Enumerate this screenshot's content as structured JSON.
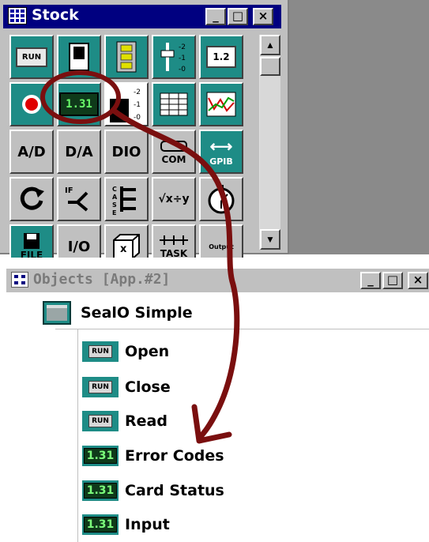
{
  "stock_window": {
    "title": "Stock",
    "buttons": [
      "_",
      "□",
      "×"
    ],
    "tools": [
      {
        "name": "run-tool",
        "kind": "run",
        "label": "RUN"
      },
      {
        "name": "switch-tool",
        "kind": "switch",
        "label": ""
      },
      {
        "name": "button-panel-tool",
        "kind": "panel",
        "label": ""
      },
      {
        "name": "slider-tool",
        "kind": "slider",
        "label": ""
      },
      {
        "name": "numeric-input-tool",
        "kind": "numeric",
        "label": "1.2"
      },
      {
        "name": "led-tool",
        "kind": "led",
        "label": ""
      },
      {
        "name": "numeric-display-tool",
        "kind": "lcd",
        "label": "1.31"
      },
      {
        "name": "bar-meter-tool",
        "kind": "bar",
        "label": ""
      },
      {
        "name": "table-tool",
        "kind": "table",
        "label": ""
      },
      {
        "name": "graph-tool",
        "kind": "graph",
        "label": ""
      },
      {
        "name": "ad-tool",
        "kind": "text",
        "label": "A/D"
      },
      {
        "name": "da-tool",
        "kind": "text",
        "label": "D/A"
      },
      {
        "name": "dio-tool",
        "kind": "text",
        "label": "DIO"
      },
      {
        "name": "com-tool",
        "kind": "com",
        "label": "COM"
      },
      {
        "name": "gpib-tool",
        "kind": "gpib",
        "label": "GPIB"
      },
      {
        "name": "loop-tool",
        "kind": "loop",
        "label": ""
      },
      {
        "name": "if-tool",
        "kind": "if",
        "label": "IF"
      },
      {
        "name": "case-tool",
        "kind": "case",
        "label": "CASE"
      },
      {
        "name": "formula-tool",
        "kind": "formula",
        "label": "√x÷y"
      },
      {
        "name": "timer-tool",
        "kind": "timer",
        "label": ""
      },
      {
        "name": "file-tool",
        "kind": "file",
        "label": "FILE"
      },
      {
        "name": "io-tool",
        "kind": "text",
        "label": "I/O"
      },
      {
        "name": "box-tool",
        "kind": "box",
        "label": "x"
      },
      {
        "name": "task-tool",
        "kind": "task",
        "label": "TASK"
      },
      {
        "name": "output-tool",
        "kind": "output",
        "label": "Output"
      }
    ]
  },
  "objects_window": {
    "title": "Objects [App.#2]",
    "buttons": [
      "_",
      "□",
      "×"
    ],
    "root": {
      "label": "SealO Simple"
    },
    "children": [
      {
        "icon": "RUN",
        "label": "Open"
      },
      {
        "icon": "RUN",
        "label": "Close"
      },
      {
        "icon": "RUN",
        "label": "Read"
      },
      {
        "icon": "1.31",
        "label": "Error Codes"
      },
      {
        "icon": "1.31",
        "label": "Card Status"
      },
      {
        "icon": "1.31",
        "label": "Input"
      }
    ]
  },
  "colors": {
    "title_active": "#000080",
    "icon_teal": "#1e8c86",
    "annotation": "#7a0f0f"
  }
}
